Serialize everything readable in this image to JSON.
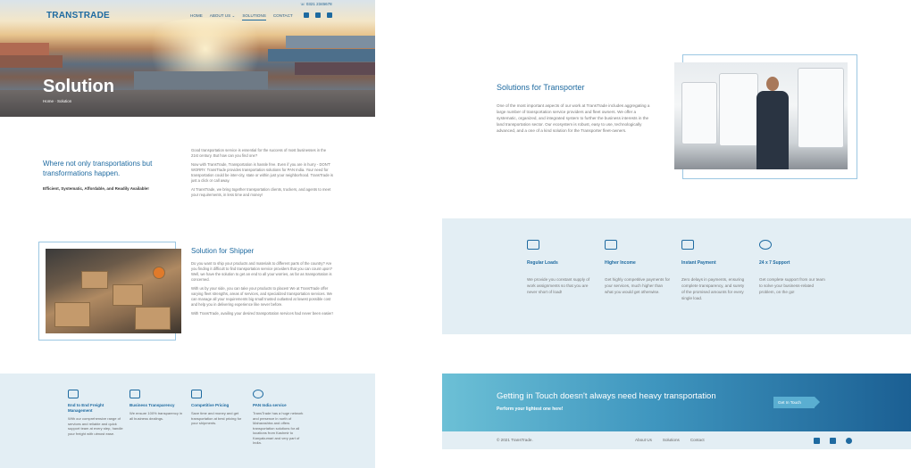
{
  "header": {
    "logo": "TRANSTRADE",
    "phone": "0321 2345678",
    "nav": [
      "HOME",
      "ABOUT US ⌄",
      "SOLUTIONS",
      "CONTACT"
    ],
    "active_nav": "SOLUTIONS"
  },
  "hero": {
    "title": "Solution",
    "breadcrumb": "Home  ·  Solution"
  },
  "intro": {
    "heading": "Where not only transportations but transformations happen.",
    "tagline": "Efficient, Systematic, Affordable, and Readily Available!",
    "paragraphs": [
      "Good transportation service is essential for the success of most businesses in the 21st century. But how can you find one?",
      "Now with TransTrade, Transportation is hassle free. Even if you are in hurry - DON'T WORRY. TransTrade provides transportation solutions for PAN India. Your need for transportation could be inter-city, state or within just your neighborhood. TransTrade is just a click or call away.",
      "At TransTrade, we bring together transportation clients, truckers, and agents to meet your requirements, in less time and money!"
    ]
  },
  "shipper": {
    "heading": "Solution for Shipper",
    "paragraphs": [
      "Do you want to ship your products and materials to different parts of the country? Are you finding it difficult to find transportation service providers that you can count upon? Well, we have the solution to get an end to all your worries, as far as transportation is concerned.",
      "With us by your side, you can take your products to places! We at TransTrade offer varying fleet strengths, areas of services, and specialized transportation services. We can manage all your requirements big small trusted outlasted at lowest possible cost and help you in delivering experience like never before.",
      "With TransTrade, availing your desired transportation services had never been easier!"
    ]
  },
  "left_features": [
    {
      "icon": "truck-icon",
      "title": "End to End Freight Management",
      "desc": "With our comprehensive range of services and reliable and quick support team at every step, handle your freight with utmost ease."
    },
    {
      "icon": "document-icon",
      "title": "Business Transparency",
      "desc": "We ensure 100% transparency in all business dealings."
    },
    {
      "icon": "money-icon",
      "title": "Competitive Pricing",
      "desc": "Save time and money and get transportation at best pricing for your shipments."
    },
    {
      "icon": "globe-icon",
      "title": "PAN India service",
      "desc": "TransTrade has a huge network and presence in north of Maharashtra and offers transportation solutions for all locations from Kashmir to Kanyakumari and very part of India."
    }
  ],
  "transporter": {
    "heading": "Solutions for Transporter",
    "paragraph": "One of the most important aspects of our work at TransTrade includes aggregating a large number of transportation service providers and fleet owners. We offer a systematic, organized, and integrated system to further the business interests in the land transportation sector. Our ecosystem is robust, easy to use, technologically advanced, and a one of a kind solution for the Transporter fleet-owners."
  },
  "right_features": [
    {
      "icon": "truck-icon",
      "title": "Regular Loads",
      "desc": "We provide you constant supply of work assignments so that you are never short of load!"
    },
    {
      "icon": "monitor-icon",
      "title": "Higher Income",
      "desc": "Get highly competitive payments for your services, much higher than what you would get otherwise."
    },
    {
      "icon": "money-icon",
      "title": "Instant Payment",
      "desc": "Zero delays in payments, ensuring complete transparency, and surety of the promised amounts for every single load."
    },
    {
      "icon": "phone-icon",
      "title": "24 x 7 Support",
      "desc": "Get complete support from our team to solve your business-related problem, on the go!"
    }
  ],
  "cta": {
    "heading": "Getting in Touch doesn't always need heavy transportation",
    "subheading": "Perform your lightest one here!",
    "button": "Get In Touch"
  },
  "footer": {
    "copyright": "© 2021 TransTrade.",
    "links": [
      "About Us",
      "Solutions",
      "Contact"
    ]
  },
  "colors": {
    "brand": "#1e6aa0",
    "band": "#e3eef4"
  }
}
